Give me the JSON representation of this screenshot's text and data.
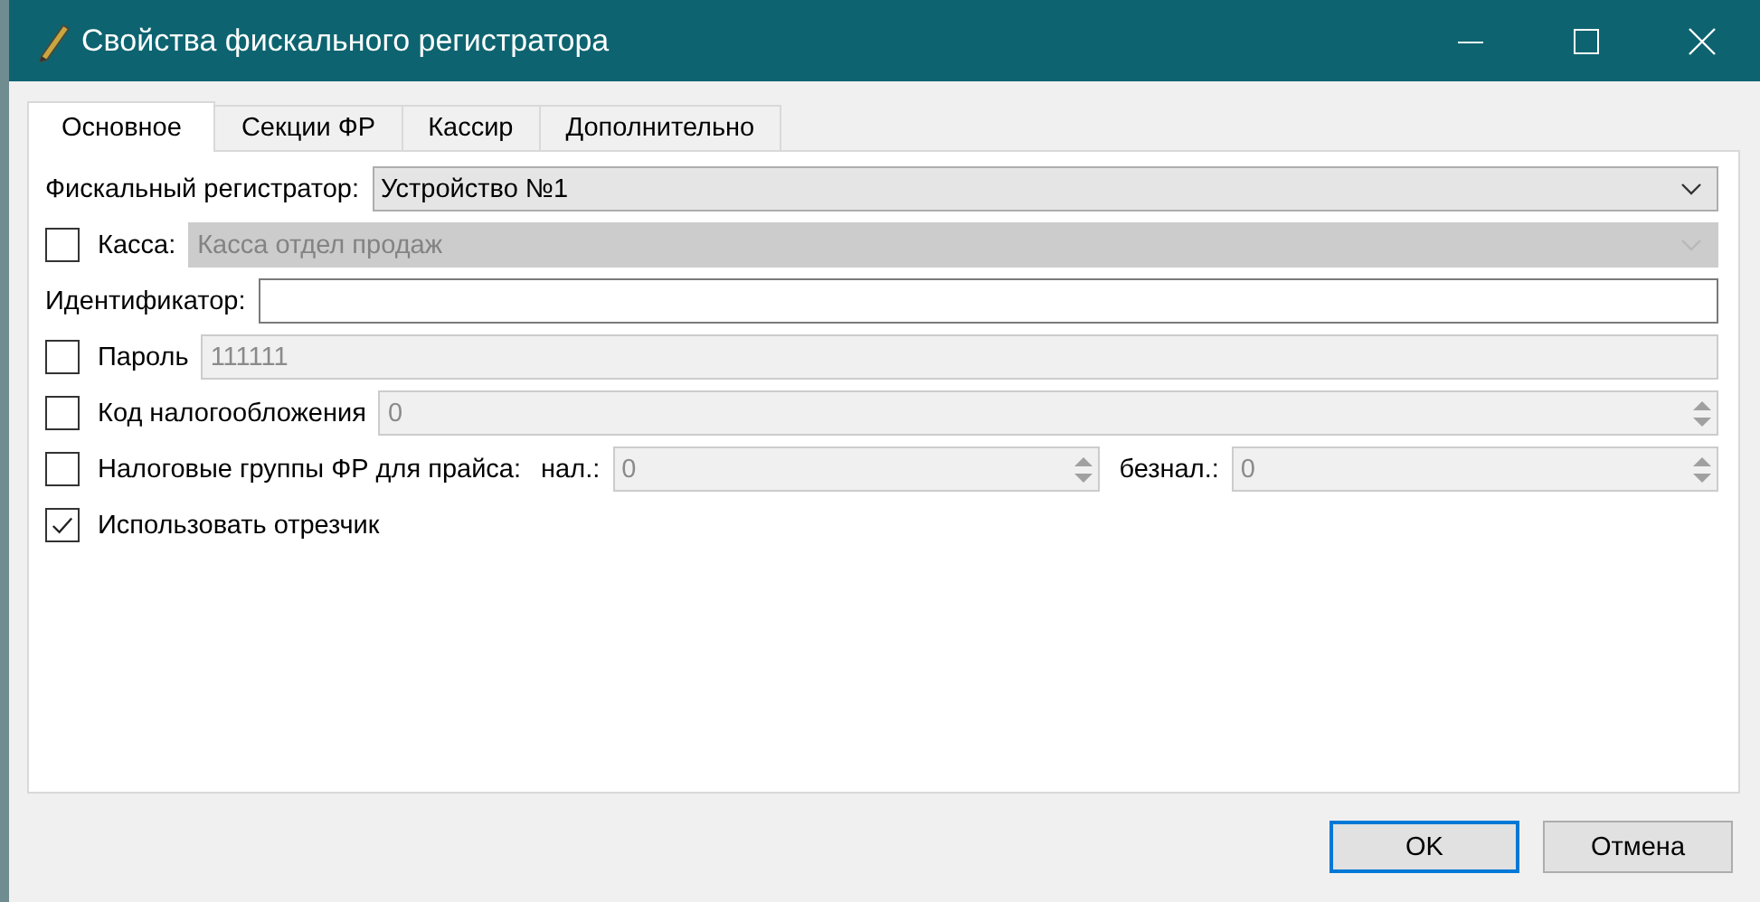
{
  "window": {
    "title": "Свойства фискального регистратора"
  },
  "tabs": [
    {
      "label": "Основное",
      "selected": true
    },
    {
      "label": "Секции ФР",
      "selected": false
    },
    {
      "label": "Кассир",
      "selected": false
    },
    {
      "label": "Дополнительно",
      "selected": false
    }
  ],
  "rows": [
    {
      "label": "Фискальный регистратор:",
      "fields": [
        {
          "kind": "combo",
          "value": "Устройство №1",
          "disabled": false
        }
      ]
    },
    {
      "checkbox": {
        "checked": false
      },
      "label": "Касса:",
      "fields": [
        {
          "kind": "combo",
          "value": "Касса отдел продаж",
          "disabled": true
        }
      ]
    },
    {
      "label": "Идентификатор:",
      "fields": [
        {
          "kind": "text",
          "disabled": false
        }
      ]
    },
    {
      "checkbox": {
        "checked": false
      },
      "label": "Пароль",
      "fields": [
        {
          "kind": "text",
          "value": "111111",
          "disabled": true
        }
      ]
    },
    {
      "checkbox": {
        "checked": false
      },
      "label": "Код налогообложения",
      "fields": [
        {
          "kind": "spin",
          "value": "0",
          "disabled": true
        }
      ]
    },
    {
      "checkbox": {
        "checked": false
      },
      "label": "Налоговые группы ФР для прайса:",
      "fields": [
        {
          "kind": "spin",
          "label": "нал.:",
          "value": "0",
          "disabled": true
        },
        {
          "kind": "spin",
          "label": "безнал.:",
          "value": "0",
          "disabled": true
        }
      ]
    },
    {
      "checkbox": {
        "checked": true
      },
      "label": "Использовать отрезчик"
    }
  ],
  "buttons": [
    {
      "label": "OK",
      "default": true
    },
    {
      "label": "Отмена",
      "default": false
    }
  ]
}
